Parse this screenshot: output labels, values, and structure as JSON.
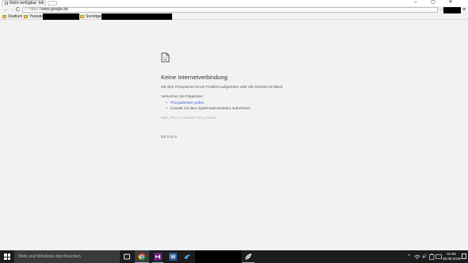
{
  "browser": {
    "tab": {
      "title": "Nicht verfügbar: htt",
      "close": "×"
    },
    "window_controls": {
      "minimize": "–",
      "maximize": "▢",
      "close": "✕"
    },
    "nav": {
      "back": "←",
      "forward": "→",
      "reload": "C"
    },
    "omnibox": {
      "scheme": "https://",
      "host": "www.google.de"
    },
    "star": "☆",
    "menu": "≡",
    "bookmarks": [
      {
        "label": "Studium"
      },
      {
        "label": "Youtube"
      },
      {
        "label": "Sonstiges"
      }
    ]
  },
  "error_page": {
    "title": "Keine Internetverbindung",
    "description": "Mit dem Proxyserver ist ein Problem aufgetreten oder die Adresse ist falsch.",
    "try_heading": "Versuchen Sie Folgendes:",
    "suggestions": [
      "Proxyadresse prüfen",
      "Kontakt mit dem Systemadministrator aufnehmen"
    ],
    "error_code": "ERR_PROXY_CONNECTION_FAILED",
    "details_button": "DETAILS"
  },
  "taskbar": {
    "search_placeholder": "Web und Windows durchsuchen",
    "tray": {
      "chevron": "^",
      "volume": "🔊"
    },
    "clock": {
      "time": "01:06",
      "date": "25.06.2016"
    }
  },
  "colors": {
    "link": "#3366cc",
    "taskbar": "#1c1c1c",
    "page_bg": "#f2f2f2"
  }
}
